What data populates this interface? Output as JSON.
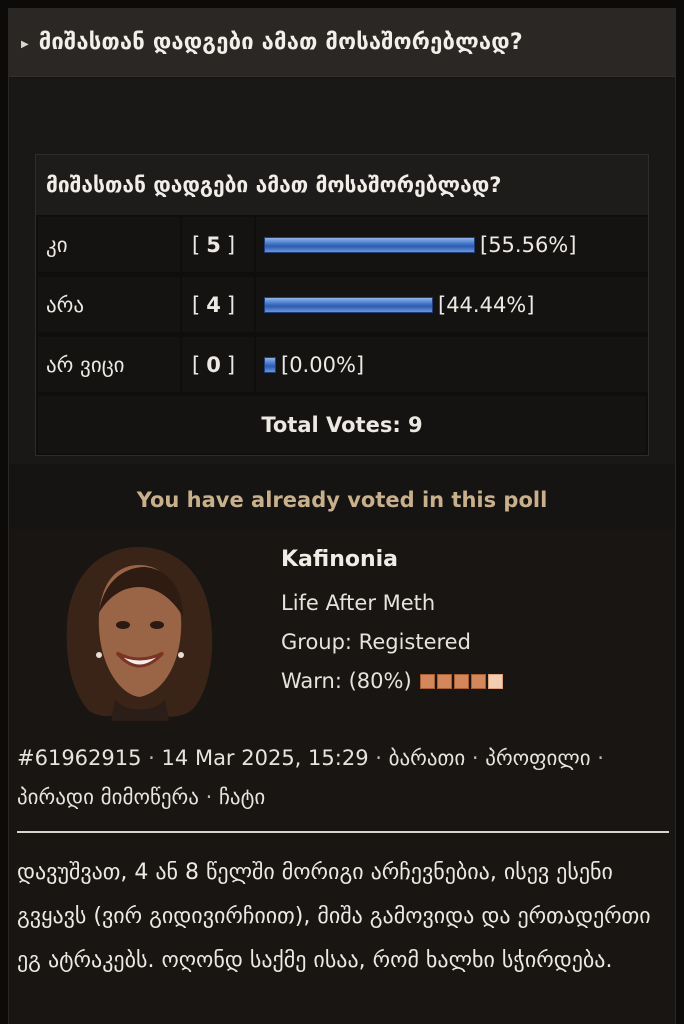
{
  "topic": {
    "arrow_icon": "triangle-right-icon",
    "title": "მიშასთან დადგები ამათ მოსაშორებლად?"
  },
  "poll": {
    "question": "მიშასთან დადგები ამათ მოსაშორებლად?",
    "bar_color": "#3d6fc4",
    "options": [
      {
        "label": "კი",
        "count": "5",
        "percent_text": "[55.56%]",
        "percent": 55.56
      },
      {
        "label": "არა",
        "count": "4",
        "percent_text": "[44.44%]",
        "percent": 44.44
      },
      {
        "label": "არ ვიცი",
        "count": "0",
        "percent_text": "[0.00%]",
        "percent": 0.0
      }
    ],
    "total_votes": "Total Votes: 9",
    "voted_message": "You have already voted in this poll"
  },
  "post": {
    "author": {
      "name": "Kafinonia",
      "title": "Life After Meth",
      "group": "Group: Registered",
      "warn_label": "Warn: (80%)",
      "warn_level": 0.8
    },
    "meta": {
      "post_id": "#61962915",
      "date": "14 Mar 2025, 15:29",
      "links": [
        "ბარათი",
        "პროფილი",
        "პირადი მიმოწერა",
        "ჩატი"
      ],
      "separator": "·"
    },
    "body": "დავუშვათ, 4 ან 8 წელში მორიგი არჩევნებია, ისევ ესენი გვყავს (ვირ გიდივირჩიით), მიშა გამოვიდა და ერთადერთი ეგ ატრაკებს. ოღონდ საქმე ისაა, რომ ხალხი სჭირდება."
  },
  "colors": {
    "page_bg": "#0c0b0a",
    "header_bg": "#2a2725",
    "voted_text": "#c9b08d",
    "warn_fill": "#d4875a",
    "warn_empty": "#f3cdb0"
  }
}
